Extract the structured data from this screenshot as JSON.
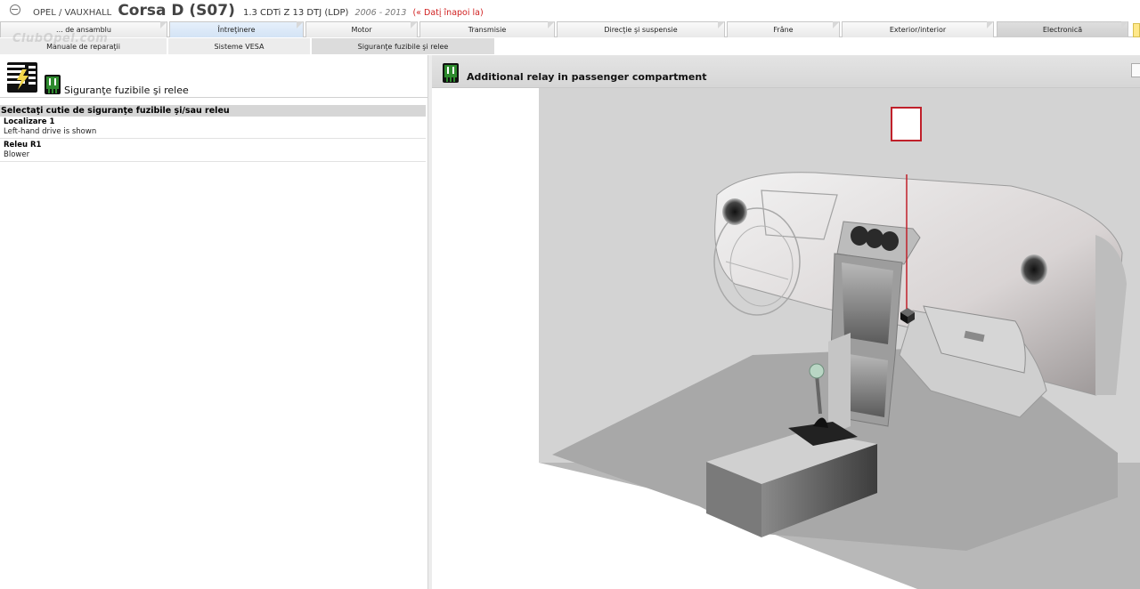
{
  "header": {
    "make": "OPEL / VAUXHALL",
    "model": "Corsa  D (S07)",
    "engine": "1.3 CDTi Z 13 DTJ (LDP)",
    "years": "2006 - 2013",
    "back_link": "(« Datį înapoi la)",
    "watermark": "ClubOpel.com"
  },
  "tabs_primary": [
    {
      "label": "... de ansamblu"
    },
    {
      "label": "Întreţinere"
    },
    {
      "label": "Motor"
    },
    {
      "label": "Transmisie"
    },
    {
      "label": "Direcţie şi suspensie"
    },
    {
      "label": "Frâne"
    },
    {
      "label": "Exterior/interior"
    },
    {
      "label": "Electronică"
    }
  ],
  "tabs_secondary": [
    {
      "label": "Manuale de reparaţii"
    },
    {
      "label": "Sisteme VESA"
    },
    {
      "label": "Siguranţe fuzibile şi relee"
    }
  ],
  "left_panel": {
    "title": "Siguranţe fuzibile şi relee",
    "section_header": "Selectaţi cutie de siguranţe fuzibile şi/sau releu",
    "items": [
      {
        "title": "Localizare 1",
        "subtitle": "Left-hand drive is shown"
      },
      {
        "title": "Releu R1",
        "subtitle": "Blower"
      }
    ]
  },
  "right_panel": {
    "title": "Additional relay in passenger compartment"
  },
  "colors": {
    "relay_green": "#2d8a2d",
    "callout_red": "#c0202a",
    "back_link_red": "#d02020",
    "active_tab_blue": "#d3e3f5"
  },
  "icons": [
    "fuse-box-icon",
    "relay-icon",
    "logo-icon"
  ]
}
